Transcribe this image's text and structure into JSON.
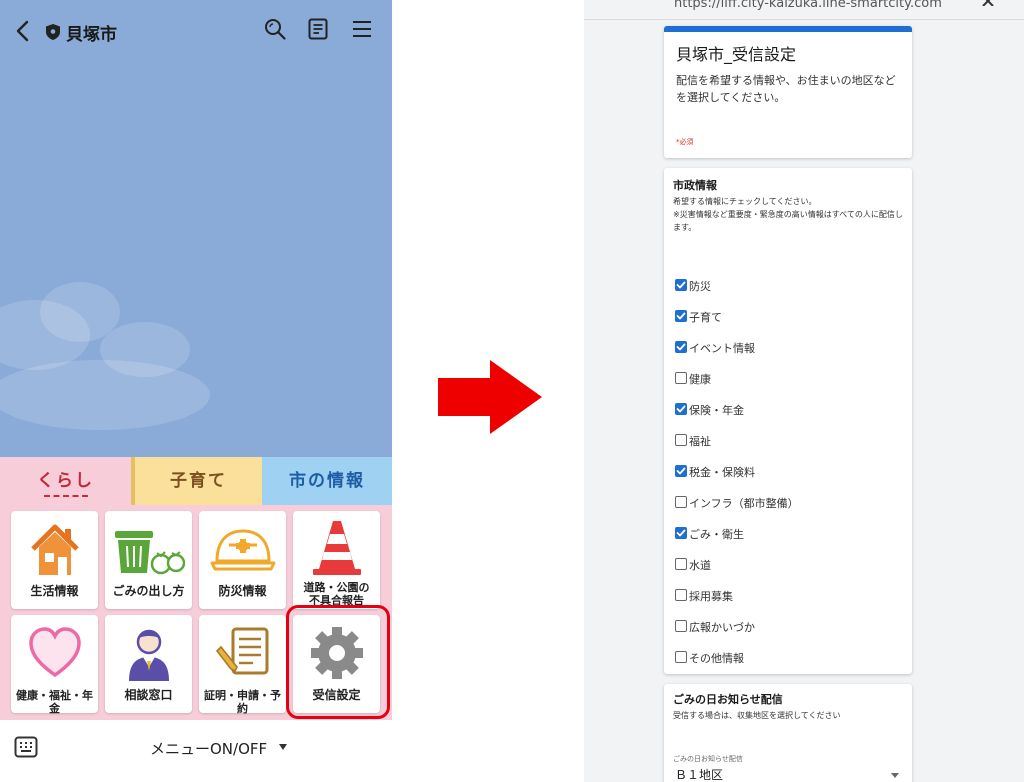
{
  "left": {
    "header": {
      "title": "貝塚市"
    },
    "tabs": [
      {
        "label": "くらし"
      },
      {
        "label": "子育て"
      },
      {
        "label": "市の情報"
      }
    ],
    "menu": [
      {
        "label": "生活情報",
        "icon": "house-icon"
      },
      {
        "label": "ごみの出し方",
        "icon": "trash-bin-icon"
      },
      {
        "label": "防災情報",
        "icon": "helmet-icon"
      },
      {
        "label": "道路・公園の\n不具合報告",
        "icon": "traffic-cone-icon"
      },
      {
        "label": "健康・福祉・年金",
        "icon": "heart-icon"
      },
      {
        "label": "相談窓口",
        "icon": "person-icon"
      },
      {
        "label": "証明・申請・予約",
        "icon": "document-pen-icon"
      },
      {
        "label": "受信設定",
        "icon": "gear-icon"
      }
    ],
    "footer": {
      "label": "メニューON/OFF"
    },
    "colors": {
      "header_bg": "#8aaad8",
      "highlight": "#e60012"
    }
  },
  "right": {
    "url": "https://liff.city-kaizuka.line-smartcity.com",
    "form": {
      "title": "貝塚市_受信設定",
      "description": "配信を希望する情報や、お住まいの地区などを選択してください。",
      "required_note": "*必須"
    },
    "shisei": {
      "heading": "市政情報",
      "note1": "希望する情報にチェックしてください。",
      "note2": "※災害情報など重要度・緊急度の高い情報はすべての人に配信します。",
      "options": [
        {
          "label": "防災",
          "checked": true
        },
        {
          "label": "子育て",
          "checked": true
        },
        {
          "label": "イベント情報",
          "checked": true
        },
        {
          "label": "健康",
          "checked": false
        },
        {
          "label": "保険・年金",
          "checked": true
        },
        {
          "label": "福祉",
          "checked": false
        },
        {
          "label": "税金・保険料",
          "checked": true
        },
        {
          "label": "インフラ（都市整備）",
          "checked": false
        },
        {
          "label": "ごみ・衛生",
          "checked": true
        },
        {
          "label": "水道",
          "checked": false
        },
        {
          "label": "採用募集",
          "checked": false
        },
        {
          "label": "広報かいづか",
          "checked": false
        },
        {
          "label": "その他情報",
          "checked": false
        }
      ]
    },
    "gomi": {
      "heading": "ごみの日お知らせ配信",
      "note": "受信する場合は、収集地区を選択してください",
      "field_label": "ごみの日お知らせ配信",
      "value": "Ｂ１地区"
    },
    "colors": {
      "accent": "#1f6fd2",
      "required": "#d93025"
    }
  }
}
